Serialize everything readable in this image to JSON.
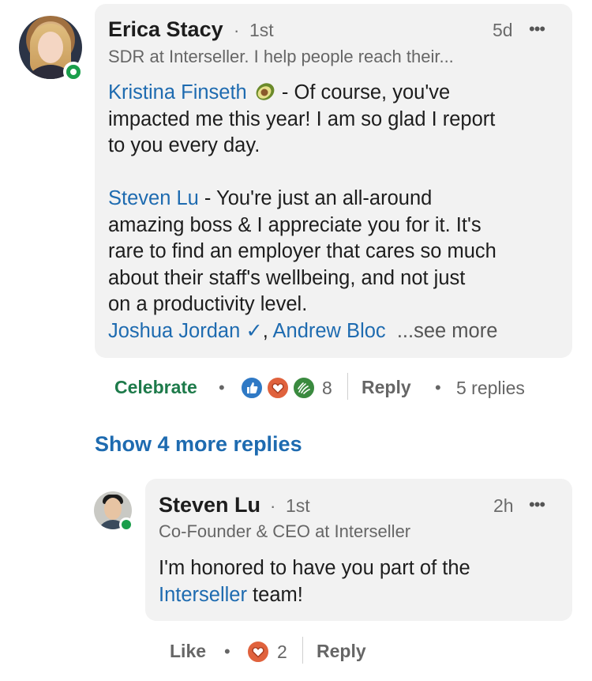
{
  "comment": {
    "author": "Erica Stacy",
    "degree": "1st",
    "headline": "SDR at Interseller. I help people reach their...",
    "time": "5d",
    "paragraphs": {
      "p1_mention": "Kristina Finseth",
      "p1_text1": " - Of course, you've",
      "p1_text2": "impacted me this year! I am so glad I report",
      "p1_text3": "to you every day.",
      "p2_mention": "Steven Lu",
      "p2_text1": " - You're just an all-around",
      "p2_text2": "amazing boss & I appreciate you for it. It's",
      "p2_text3": "rare to find an employer that cares so much",
      "p2_text4": "about their staff's wellbeing, and not just",
      "p2_text5": "on a productivity level.",
      "p3_mention1": "Joshua Jordan ✓",
      "p3_comma": ",",
      "p3_mention2": "Andrew Bloc",
      "see_more": "...see more"
    },
    "actions": {
      "reaction_label": "Celebrate",
      "reaction_count": "8",
      "reply_label": "Reply",
      "replies_count": "5 replies"
    }
  },
  "show_more_replies": "Show 4 more replies",
  "reply": {
    "author": "Steven Lu",
    "degree": "1st",
    "headline": "Co-Founder & CEO at Interseller",
    "time": "2h",
    "text1": "I'm honored to have you part of the",
    "mention": "Interseller",
    "text2": " team!",
    "actions": {
      "like_label": "Like",
      "reaction_count": "2",
      "reply_label": "Reply"
    }
  },
  "colors": {
    "link": "#1e6bb0",
    "celebrate": "#1d7a4a",
    "presence": "#1a9e4b",
    "bubble": "#f2f2f2"
  },
  "icons": {
    "more": "more-horizontal-icon",
    "like": "like-reaction-icon",
    "love": "love-reaction-icon",
    "celebrate": "celebrate-reaction-icon"
  }
}
